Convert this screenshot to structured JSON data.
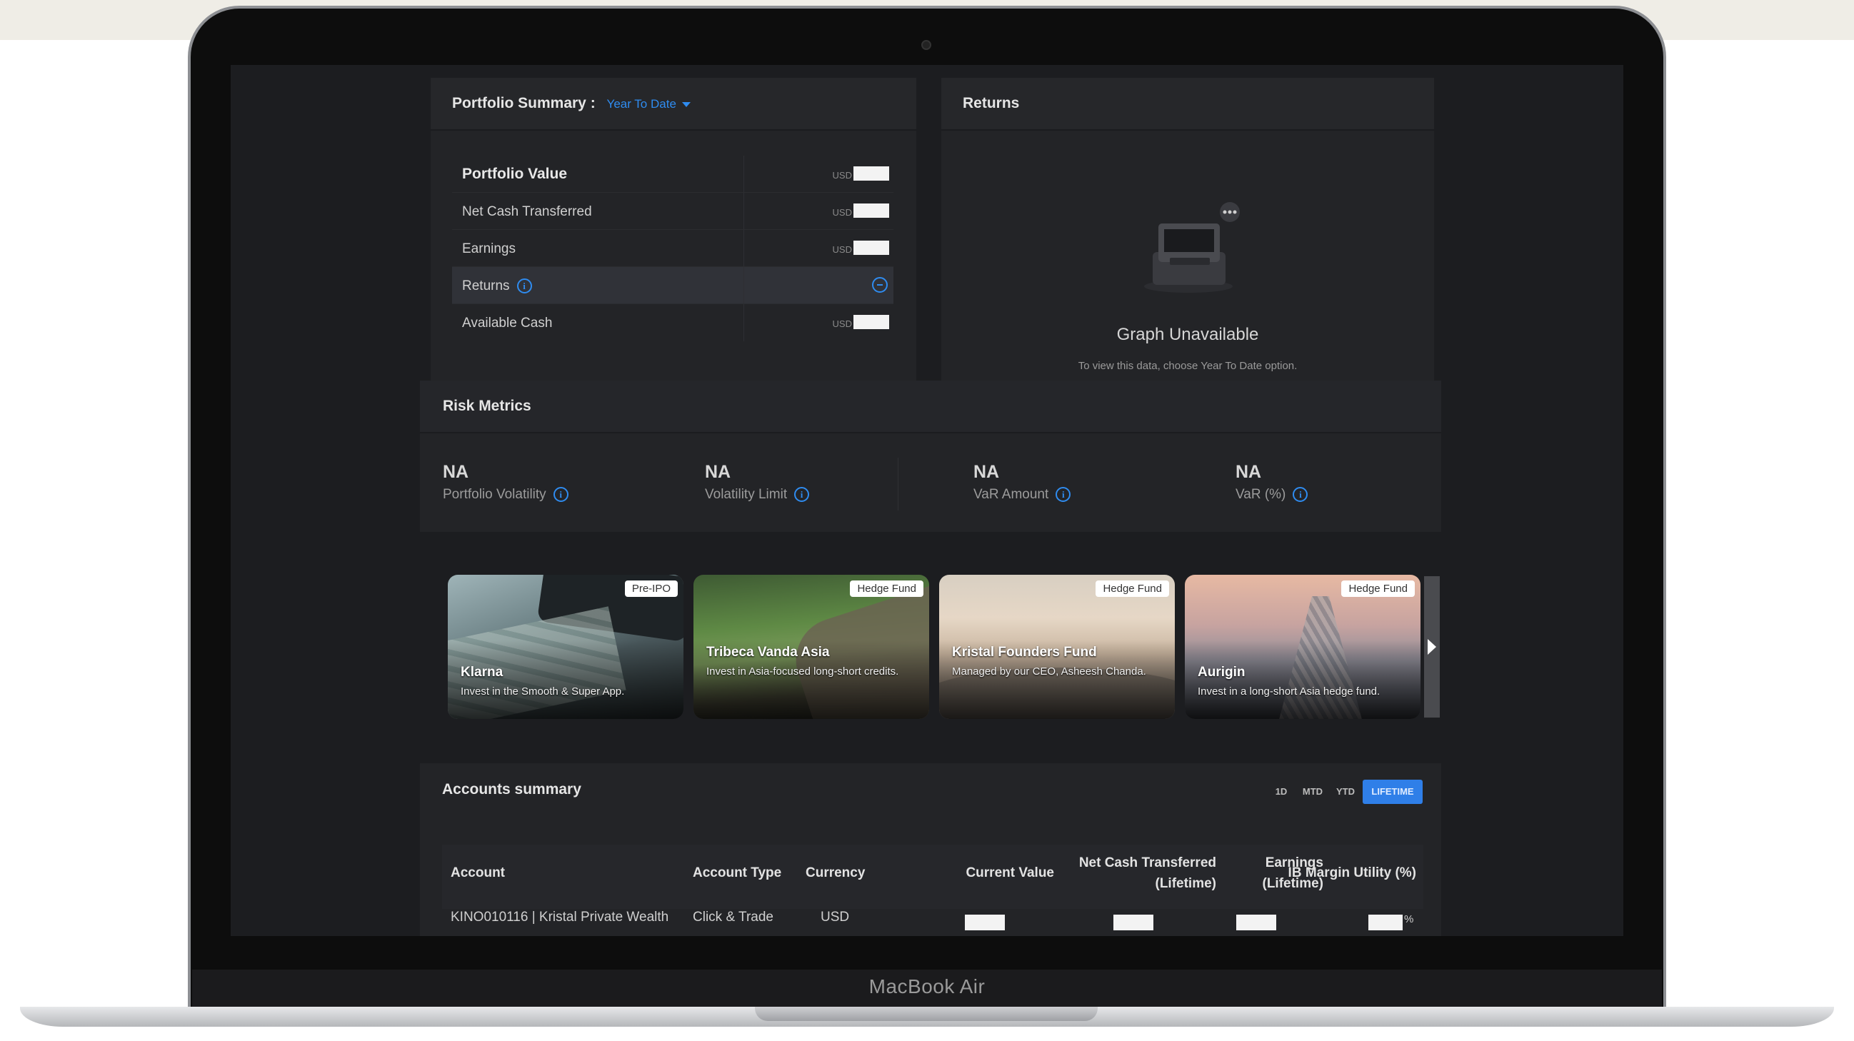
{
  "device": {
    "brand": "MacBook Air"
  },
  "portfolio_summary": {
    "title": "Portfolio Summary :",
    "period": "Year To Date",
    "rows": [
      {
        "label": "Portfolio Value",
        "currency": "USD"
      },
      {
        "label": "Net Cash Transferred",
        "currency": "USD"
      },
      {
        "label": "Earnings",
        "currency": "USD"
      },
      {
        "label": "Returns",
        "currency": ""
      },
      {
        "label": "Available Cash",
        "currency": "USD"
      }
    ]
  },
  "returns": {
    "title": "Returns",
    "empty_title": "Graph Unavailable",
    "empty_subtitle": "To view this data, choose Year To Date option."
  },
  "risk_metrics": {
    "title": "Risk Metrics",
    "items": [
      {
        "value": "NA",
        "label": "Portfolio Volatility"
      },
      {
        "value": "NA",
        "label": "Volatility Limit"
      },
      {
        "value": "NA",
        "label": "VaR Amount"
      },
      {
        "value": "NA",
        "label": "VaR (%)"
      }
    ]
  },
  "products": [
    {
      "badge": "Pre-IPO",
      "title": "Klarna",
      "desc": "Invest in the Smooth & Super App."
    },
    {
      "badge": "Hedge Fund",
      "title": "Tribeca Vanda Asia",
      "desc": "Invest in Asia-focused long-short credits."
    },
    {
      "badge": "Hedge Fund",
      "title": "Kristal Founders Fund",
      "desc": "Managed by our CEO, Asheesh Chanda."
    },
    {
      "badge": "Hedge Fund",
      "title": "Aurigin",
      "desc": "Invest in a long-short Asia hedge fund."
    }
  ],
  "accounts_summary": {
    "title": "Accounts summary",
    "periods": [
      "1D",
      "MTD",
      "YTD",
      "LIFETIME"
    ],
    "active_period": "LIFETIME",
    "columns": [
      "Account",
      "Account Type",
      "Currency",
      "Current Value",
      "Net Cash Transferred (Lifetime)",
      "Earnings (Lifetime)",
      "IB Margin Utility (%)"
    ],
    "column_lines": [
      [
        "Account"
      ],
      [
        "Account Type"
      ],
      [
        "Currency"
      ],
      [
        "Current Value"
      ],
      [
        "Net Cash Transferred",
        "(Lifetime)"
      ],
      [
        "Earnings",
        "(Lifetime)"
      ],
      [
        "IB Margin Utility (%)"
      ]
    ],
    "rows": [
      {
        "account": "KINO010116 | Kristal Private Wealth",
        "type": "Click & Trade",
        "currency": "USD",
        "margin_suffix": "%"
      }
    ]
  },
  "colors": {
    "accent": "#2f8cf0",
    "panel": "#232427",
    "screen_bg": "#1c1d20"
  }
}
